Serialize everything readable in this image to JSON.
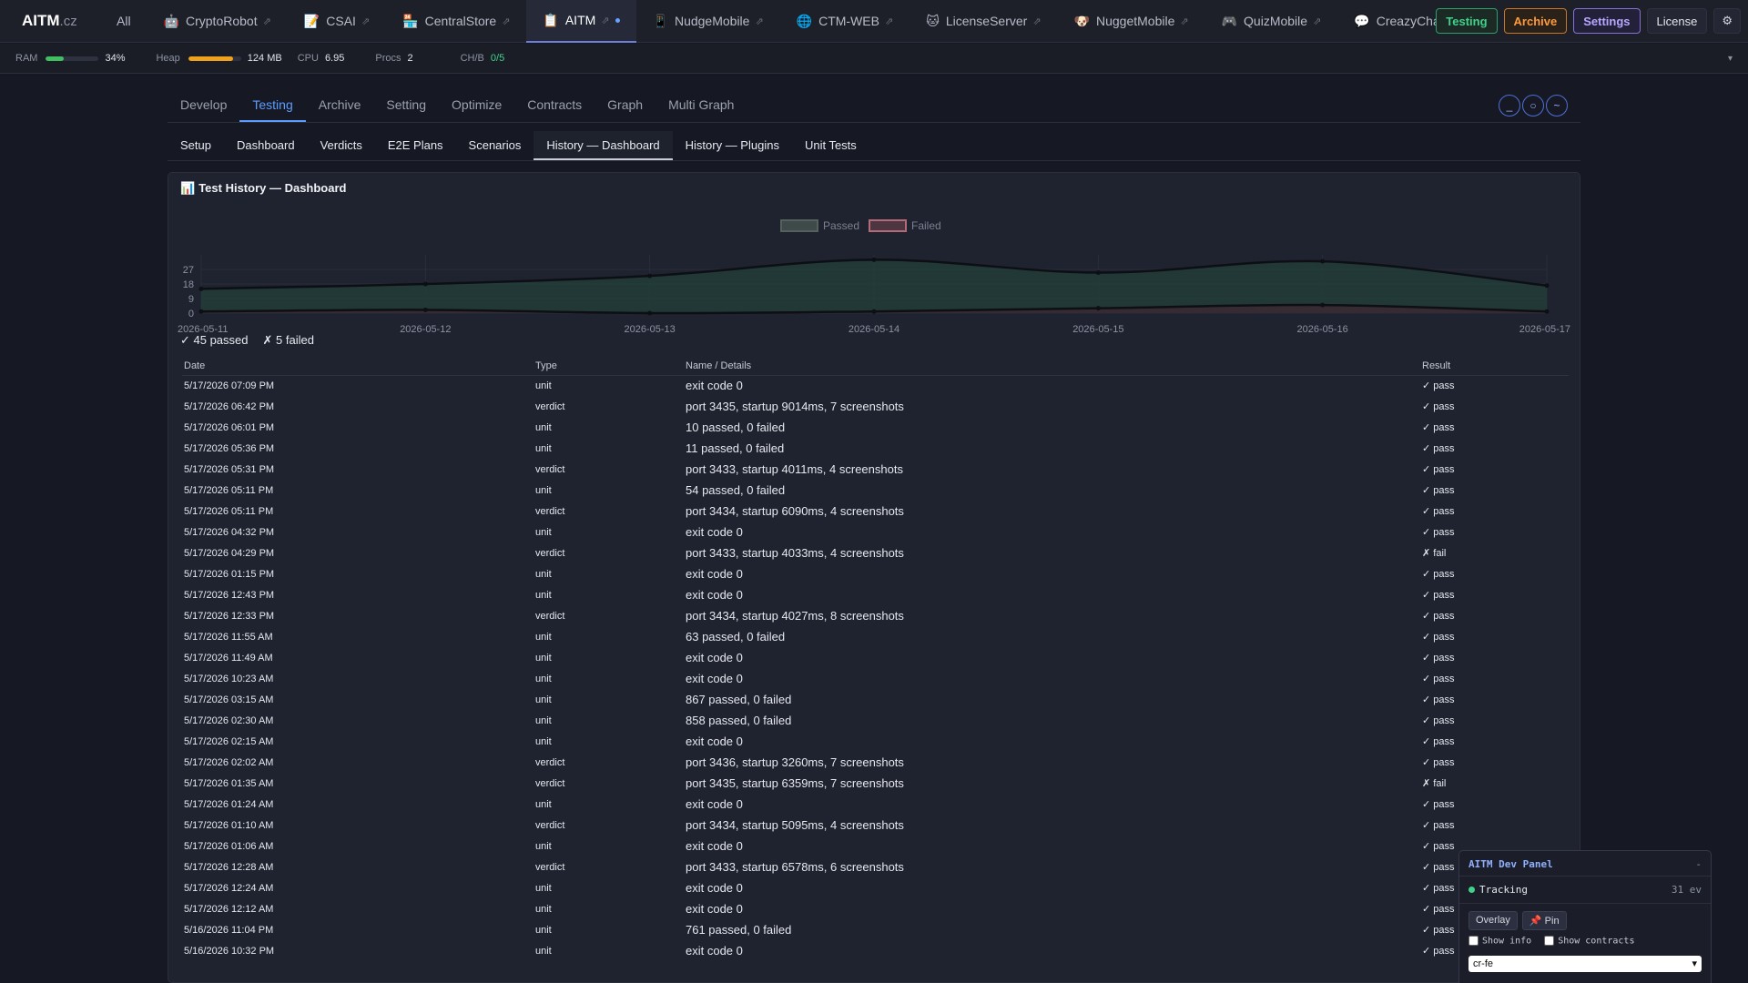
{
  "brand": {
    "name": "AITM",
    "tld": ".cz"
  },
  "project_tabs": [
    {
      "label": "All",
      "icon": "",
      "ext": ""
    },
    {
      "label": "CryptoRobot",
      "icon": "🤖",
      "ext": "⇗"
    },
    {
      "label": "CSAI",
      "icon": "📝",
      "ext": "⇗"
    },
    {
      "label": "CentralStore",
      "icon": "🏪",
      "ext": "⇗"
    },
    {
      "label": "AITM",
      "icon": "📋",
      "ext": "⇗"
    },
    {
      "label": "NudgeMobile",
      "icon": "📱",
      "ext": "⇗"
    },
    {
      "label": "CTM-WEB",
      "icon": "🌐",
      "ext": "⇗"
    },
    {
      "label": "LicenseServer",
      "icon": "🐱",
      "ext": "⇗"
    },
    {
      "label": "NuggetMobile",
      "icon": "🐶",
      "ext": "⇗"
    },
    {
      "label": "QuizMobile",
      "icon": "🎮",
      "ext": "⇗"
    },
    {
      "label": "CreazyChat",
      "icon": "💬",
      "ext": "⇗"
    }
  ],
  "active_project": "AITM",
  "top_buttons": {
    "testing": "Testing",
    "archive": "Archive",
    "settings": "Settings",
    "license": "License",
    "gear": "⚙"
  },
  "stats": {
    "ram_label": "RAM",
    "ram_value": "34%",
    "ram_level": 0.34,
    "heap_label": "Heap",
    "heap_value": "124 MB",
    "heap_level": 0.85,
    "cpu_label": "CPU",
    "cpu_value": "6.95",
    "procs_label": "Procs",
    "procs_value": "2",
    "chb_label": "CH/B",
    "chb_value": "0/5",
    "collapse": "▾"
  },
  "main_tabs": [
    "Develop",
    "Testing",
    "Archive",
    "Setting",
    "Optimize",
    "Contracts",
    "Graph",
    "Multi Graph"
  ],
  "main_active": "Testing",
  "window_controls": [
    "_",
    "○",
    "~"
  ],
  "sub_tabs": [
    "Setup",
    "Dashboard",
    "Verdicts",
    "E2E Plans",
    "Scenarios",
    "History — Dashboard",
    "History — Plugins",
    "Unit Tests"
  ],
  "sub_active": "History — Dashboard",
  "panel": {
    "icon": "📊",
    "title": "Test History — Dashboard"
  },
  "summary": {
    "passed": "✓ 45 passed",
    "failed": "✗ 5 failed"
  },
  "chart_data": {
    "type": "area",
    "legend": [
      "Passed",
      "Failed"
    ],
    "legend_position": "top-center",
    "colors": {
      "passed_line": "#0d0f14",
      "passed_fill": "#23403a",
      "failed_line": "#0d0f14",
      "failed_fill": "#3a2a33"
    },
    "x": [
      "2026-05-11",
      "2026-05-12",
      "2026-05-13",
      "2026-05-14",
      "2026-05-15",
      "2026-05-16",
      "2026-05-17"
    ],
    "series": [
      {
        "name": "Passed",
        "values": [
          15,
          18,
          23,
          33,
          25,
          32,
          17
        ]
      },
      {
        "name": "Failed",
        "values": [
          1,
          2,
          0,
          1,
          3,
          5,
          1
        ]
      }
    ],
    "yticks": [
      0,
      9,
      18,
      27
    ],
    "ylim": [
      0,
      36
    ],
    "grid": true
  },
  "table": {
    "headers": [
      "Date",
      "Type",
      "Name / Details",
      "Result"
    ],
    "rows": [
      [
        "5/17/2026 07:09 PM",
        "unit",
        "exit code 0",
        "✓ pass"
      ],
      [
        "5/17/2026 06:42 PM",
        "verdict",
        "port 3435, startup 9014ms, 7 screenshots",
        "✓ pass"
      ],
      [
        "5/17/2026 06:01 PM",
        "unit",
        "10 passed, 0 failed",
        "✓ pass"
      ],
      [
        "5/17/2026 05:36 PM",
        "unit",
        "11 passed, 0 failed",
        "✓ pass"
      ],
      [
        "5/17/2026 05:31 PM",
        "verdict",
        "port 3433, startup 4011ms, 4 screenshots",
        "✓ pass"
      ],
      [
        "5/17/2026 05:11 PM",
        "unit",
        "54 passed, 0 failed",
        "✓ pass"
      ],
      [
        "5/17/2026 05:11 PM",
        "verdict",
        "port 3434, startup 6090ms, 4 screenshots",
        "✓ pass"
      ],
      [
        "5/17/2026 04:32 PM",
        "unit",
        "exit code 0",
        "✓ pass"
      ],
      [
        "5/17/2026 04:29 PM",
        "verdict",
        "port 3433, startup 4033ms, 4 screenshots",
        "✗ fail"
      ],
      [
        "5/17/2026 01:15 PM",
        "unit",
        "exit code 0",
        "✓ pass"
      ],
      [
        "5/17/2026 12:43 PM",
        "unit",
        "exit code 0",
        "✓ pass"
      ],
      [
        "5/17/2026 12:33 PM",
        "verdict",
        "port 3434, startup 4027ms, 8 screenshots",
        "✓ pass"
      ],
      [
        "5/17/2026 11:55 AM",
        "unit",
        "63 passed, 0 failed",
        "✓ pass"
      ],
      [
        "5/17/2026 11:49 AM",
        "unit",
        "exit code 0",
        "✓ pass"
      ],
      [
        "5/17/2026 10:23 AM",
        "unit",
        "exit code 0",
        "✓ pass"
      ],
      [
        "5/17/2026 03:15 AM",
        "unit",
        "867 passed, 0 failed",
        "✓ pass"
      ],
      [
        "5/17/2026 02:30 AM",
        "unit",
        "858 passed, 0 failed",
        "✓ pass"
      ],
      [
        "5/17/2026 02:15 AM",
        "unit",
        "exit code 0",
        "✓ pass"
      ],
      [
        "5/17/2026 02:02 AM",
        "verdict",
        "port 3436, startup 3260ms, 7 screenshots",
        "✓ pass"
      ],
      [
        "5/17/2026 01:35 AM",
        "verdict",
        "port 3435, startup 6359ms, 7 screenshots",
        "✗ fail"
      ],
      [
        "5/17/2026 01:24 AM",
        "unit",
        "exit code 0",
        "✓ pass"
      ],
      [
        "5/17/2026 01:10 AM",
        "verdict",
        "port 3434, startup 5095ms, 4 screenshots",
        "✓ pass"
      ],
      [
        "5/17/2026 01:06 AM",
        "unit",
        "exit code 0",
        "✓ pass"
      ],
      [
        "5/17/2026 12:28 AM",
        "verdict",
        "port 3433, startup 6578ms, 6 screenshots",
        "✓ pass"
      ],
      [
        "5/17/2026 12:24 AM",
        "unit",
        "exit code 0",
        "✓ pass"
      ],
      [
        "5/17/2026 12:12 AM",
        "unit",
        "exit code 0",
        "✓ pass"
      ],
      [
        "5/16/2026 11:04 PM",
        "unit",
        "761 passed, 0 failed",
        "✓ pass"
      ],
      [
        "5/16/2026 10:32 PM",
        "unit",
        "exit code 0",
        "✓ pass"
      ]
    ]
  },
  "dev_panel": {
    "title": "AITM Dev Panel",
    "minimize": "-",
    "status": "Tracking",
    "events": "31 ev",
    "overlay_btn": "Overlay",
    "pin_btn": "📌 Pin",
    "show_info": "Show info",
    "show_contracts": "Show contracts",
    "select_value": "cr-fe"
  }
}
